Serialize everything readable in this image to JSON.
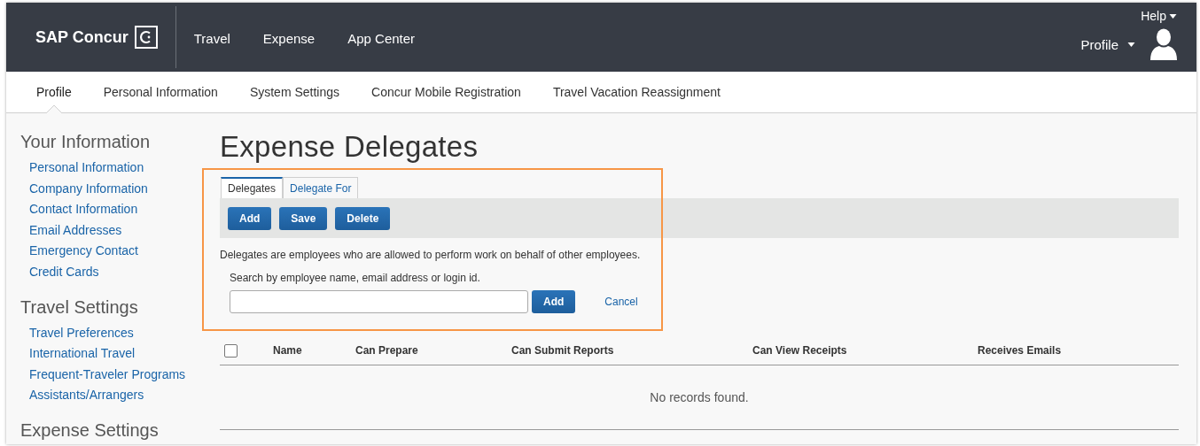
{
  "header": {
    "logo": "SAP Concur",
    "nav": [
      {
        "label": "Travel"
      },
      {
        "label": "Expense"
      },
      {
        "label": "App Center"
      }
    ],
    "help": "Help",
    "profile": "Profile"
  },
  "subnav": [
    {
      "label": "Profile",
      "selected": true
    },
    {
      "label": "Personal Information",
      "selected": false
    },
    {
      "label": "System Settings",
      "selected": false
    },
    {
      "label": "Concur Mobile Registration",
      "selected": false
    },
    {
      "label": "Travel Vacation Reassignment",
      "selected": false
    }
  ],
  "sidebar": [
    {
      "heading": "Your Information",
      "items": [
        "Personal Information",
        "Company Information",
        "Contact Information",
        "Email Addresses",
        "Emergency Contact",
        "Credit Cards"
      ]
    },
    {
      "heading": "Travel Settings",
      "items": [
        "Travel Preferences",
        "International Travel",
        "Frequent-Traveler Programs",
        "Assistants/Arrangers"
      ]
    },
    {
      "heading": "Expense Settings"
    }
  ],
  "page_title": "Expense Delegates",
  "tabs": [
    {
      "label": "Delegates",
      "selected": true
    },
    {
      "label": "Delegate For",
      "selected": false
    }
  ],
  "toolbar": [
    "Add",
    "Save",
    "Delete"
  ],
  "description": "Delegates are employees who are allowed to perform work on behalf of other employees.",
  "search": {
    "label": "Search by employee name, email address or login id.",
    "button": "Add",
    "cancel": "Cancel"
  },
  "table": {
    "select_all_checked": false,
    "columns": [
      "Name",
      "Can Prepare",
      "Can Submit Reports",
      "Can View Receipts",
      "Receives Emails"
    ],
    "empty_message": "No records found."
  }
}
